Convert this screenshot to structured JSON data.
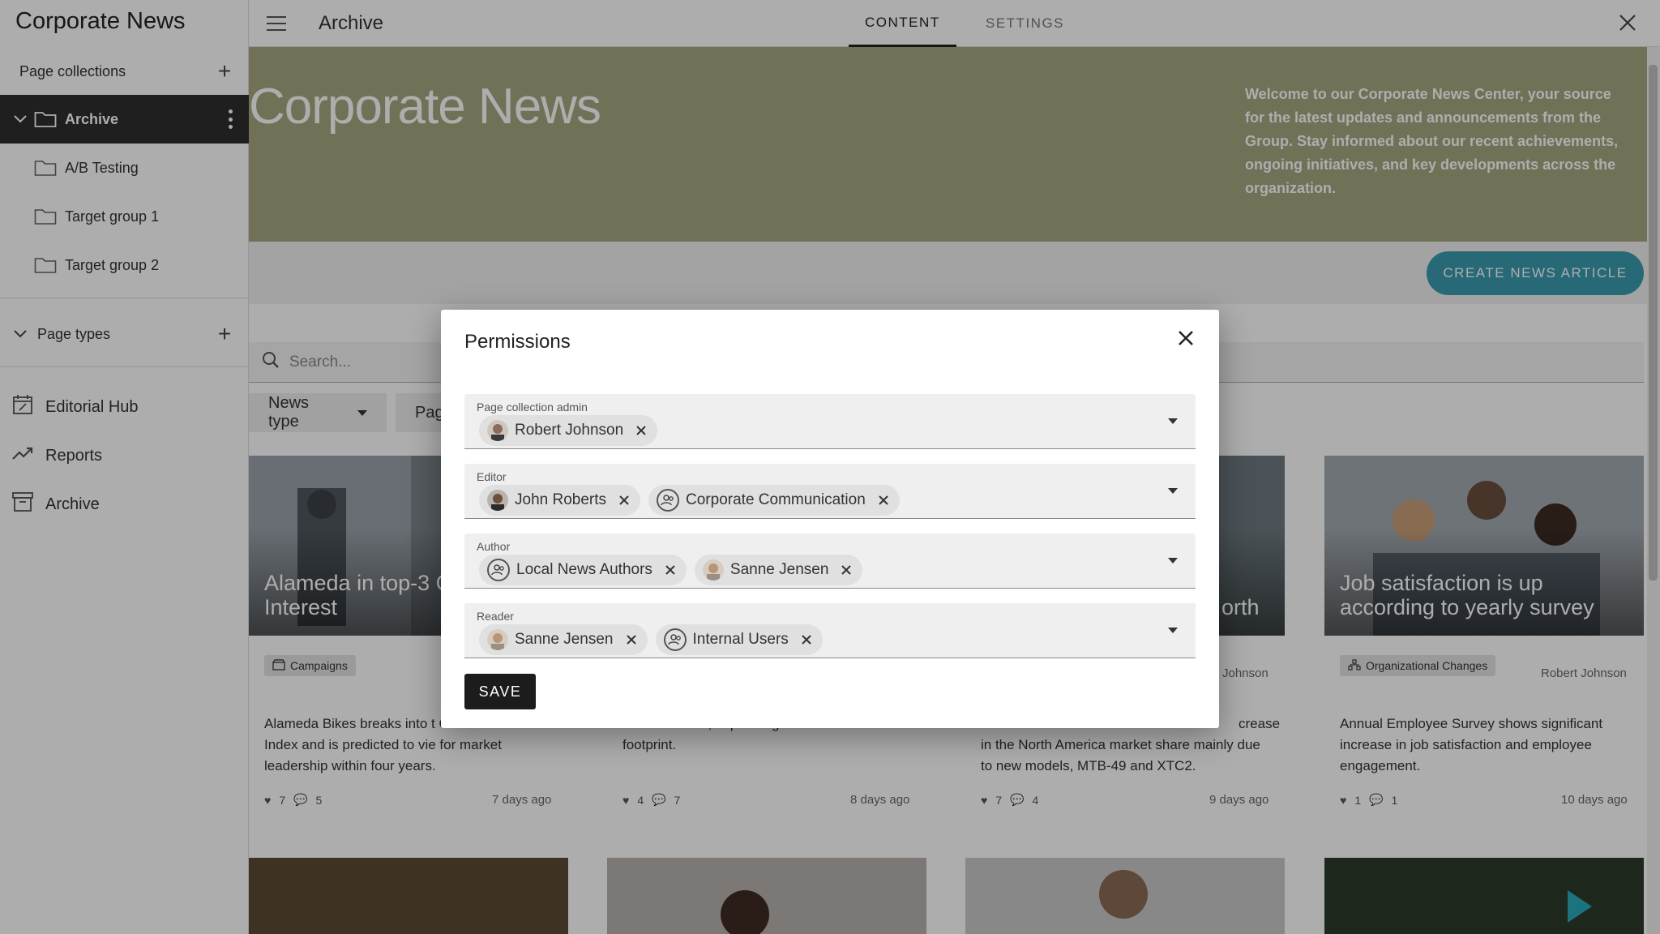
{
  "app": {
    "title": "Corporate News"
  },
  "sidebar": {
    "collections_label": "Page collections",
    "collections": [
      {
        "label": "Archive",
        "active": true
      },
      {
        "label": "A/B Testing"
      },
      {
        "label": "Target group 1"
      },
      {
        "label": "Target group 2"
      }
    ],
    "page_types_label": "Page types",
    "nav": [
      {
        "label": "Editorial Hub",
        "icon": "calendar-edit-icon"
      },
      {
        "label": "Reports",
        "icon": "trending-up-icon"
      },
      {
        "label": "Archive",
        "icon": "archive-box-icon"
      }
    ]
  },
  "topbar": {
    "page_title": "Archive",
    "tabs": [
      {
        "label": "CONTENT",
        "active": true
      },
      {
        "label": "SETTINGS"
      }
    ]
  },
  "hero": {
    "title": "Corporate News",
    "text": "Welcome to our Corporate News Center, your source for the latest updates and announcements from the Group. Stay informed about our recent achievements, ongoing initiatives, and key developments across the organization.",
    "bg_color": "#a7a781"
  },
  "actions": {
    "create_label": "CREATE NEWS ARTICLE",
    "accent": "#3a9bb0"
  },
  "search": {
    "placeholder": "Search..."
  },
  "filters": [
    {
      "label": "News type"
    },
    {
      "label": "Pag"
    }
  ],
  "cards": [
    {
      "title": "Alameda in top-3 Customer Interest",
      "tag": "Campaigns",
      "author": "",
      "text": "Alameda Bikes breaks into t Customer Interest Index and is predicted to vie for market leadership within four years.",
      "likes": "7",
      "comments": "5",
      "date": "7 days ago"
    },
    {
      "title": "",
      "tag": "",
      "author": "",
      "text": "office in Brazil, expanding its South American footprint.",
      "likes": "4",
      "comments": "7",
      "date": "8 days ago"
    },
    {
      "title": "orth",
      "tag": "",
      "author": "Johnson",
      "text": "in the North America market share mainly due to new models, MTB-49 and XTC2.",
      "text_prefix": "crease",
      "likes": "7",
      "comments": "4",
      "date": "9 days ago"
    },
    {
      "title": "Job satisfaction is up according to yearly survey",
      "tag": "Organizational Changes",
      "author": "Robert Johnson",
      "text": "Annual Employee Survey shows significant increase in job satisfaction and employee engagement.",
      "likes": "1",
      "comments": "1",
      "date": "10 days ago"
    }
  ],
  "modal": {
    "title": "Permissions",
    "save_label": "SAVE",
    "fields": [
      {
        "label": "Page collection admin",
        "chips": [
          {
            "name": "Robert Johnson",
            "kind": "user"
          }
        ]
      },
      {
        "label": "Editor",
        "chips": [
          {
            "name": "John Roberts",
            "kind": "user"
          },
          {
            "name": "Corporate Communication",
            "kind": "group"
          }
        ]
      },
      {
        "label": "Author",
        "chips": [
          {
            "name": "Local News Authors",
            "kind": "group"
          },
          {
            "name": "Sanne Jensen",
            "kind": "user"
          }
        ]
      },
      {
        "label": "Reader",
        "chips": [
          {
            "name": "Sanne Jensen",
            "kind": "user"
          },
          {
            "name": "Internal Users",
            "kind": "group"
          }
        ]
      }
    ]
  }
}
